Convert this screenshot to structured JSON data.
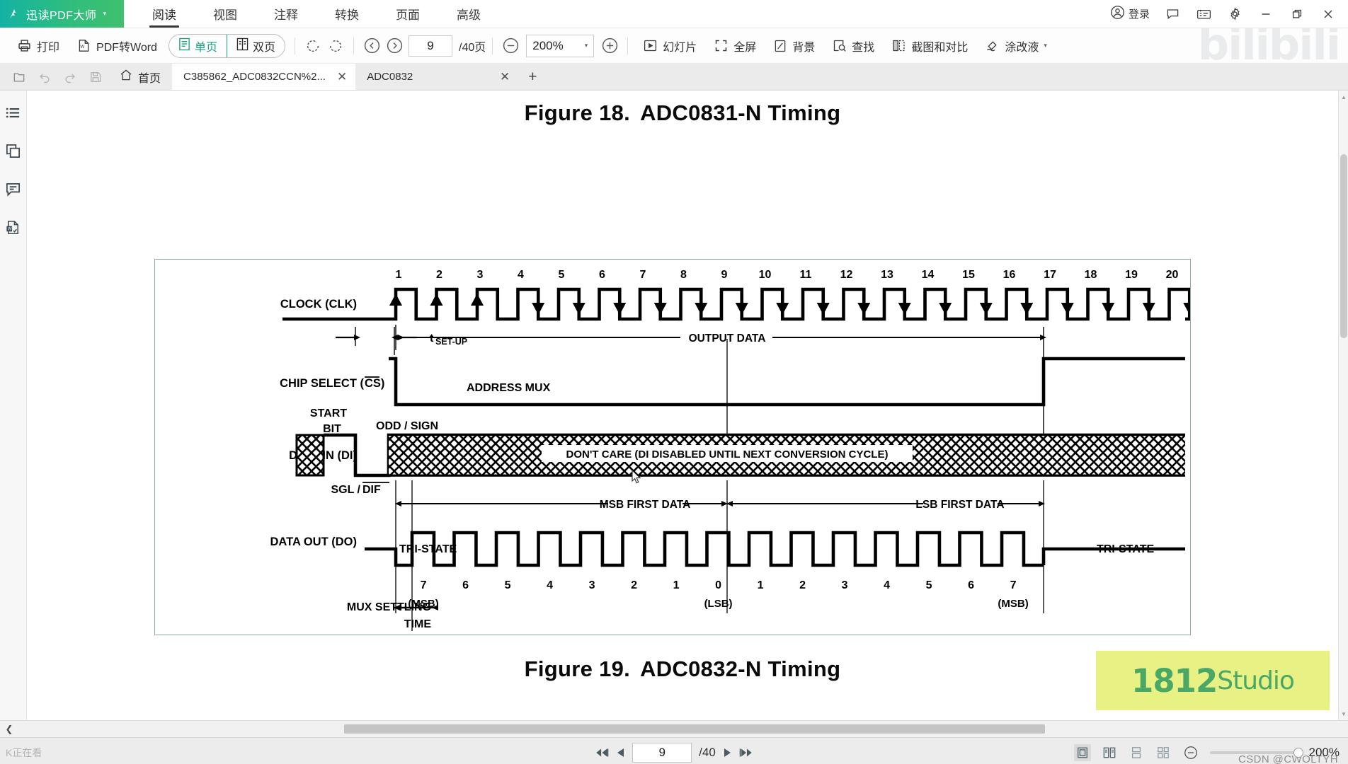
{
  "app": {
    "brand": "迅读PDF大师",
    "brand_caret": "▾",
    "accent": "#2fbd7e",
    "login_label": "登录",
    "watermark_bili": "bilibili",
    "watermark_studio_num": "1812",
    "watermark_studio_word": "Studio",
    "watermark_csdn": "CSDN @CWOLTYH"
  },
  "menu": {
    "tabs": [
      {
        "label": "阅读",
        "active": true
      },
      {
        "label": "视图",
        "active": false
      },
      {
        "label": "注释",
        "active": false
      },
      {
        "label": "转换",
        "active": false
      },
      {
        "label": "页面",
        "active": false
      },
      {
        "label": "高级",
        "active": false
      }
    ]
  },
  "window_controls": {
    "feedback": "comment-icon",
    "keyboard": "keyboard-icon",
    "settings": "gear-icon",
    "minimize": "—",
    "restore": "restore-icon",
    "close": "✕"
  },
  "toolbar": {
    "print": "打印",
    "pdf_to_word": "PDF转Word",
    "single_page": "单页",
    "double_page": "双页",
    "page_mode_selected": "单页",
    "rotate_cw": "rotate-cw-icon",
    "rotate_ccw": "rotate-ccw-icon",
    "prev_page": "prev-page-icon",
    "next_page": "next-page-icon",
    "page_number": "9",
    "page_total": "/40页",
    "zoom_out": "zoom-out-icon",
    "zoom_value": "200%",
    "zoom_caret": "▾",
    "zoom_in": "zoom-in-icon",
    "slideshow": "幻灯片",
    "fullscreen": "全屏",
    "background": "背景",
    "find": "查找",
    "screenshot_compare": "截图和对比",
    "whiteout": "涂改液",
    "whiteout_caret": "▾"
  },
  "tabstrip": {
    "open_icon": "open-file-icon",
    "undo_icon": "undo-icon",
    "redo_icon": "redo-icon",
    "save_icon": "save-icon",
    "home_label": "首页",
    "tabs": [
      {
        "label": "C385862_ADC0832CCN%2...",
        "active": true,
        "close": "✕"
      },
      {
        "label": "ADC0832",
        "active": false,
        "close": "✕"
      }
    ],
    "add_tab": "+"
  },
  "sidebar": {
    "items": [
      {
        "name": "outline",
        "icon": "list-icon"
      },
      {
        "name": "thumbnails",
        "icon": "pages-icon"
      },
      {
        "name": "comments",
        "icon": "comment-bubble-icon"
      },
      {
        "name": "convert-word",
        "icon": "word-doc-icon"
      }
    ]
  },
  "document": {
    "figure_18_title_prefix": "Figure 18.",
    "figure_18_title_main": "ADC0831-N Timing",
    "figure_19_title_prefix": "Figure 19.",
    "figure_19_title_main": "ADC0832-N Timing"
  },
  "chart_data": {
    "type": "timing-diagram",
    "title": "ADC0831-N Timing",
    "signals": [
      {
        "name": "CLOCK (CLK)",
        "label": "CLOCK (CLK)"
      },
      {
        "name": "CHIP SELECT",
        "label": "CHIP SELECT (CS)",
        "overline": "CS"
      },
      {
        "name": "DATA IN",
        "label": "DATA IN (DI)"
      },
      {
        "name": "DATA OUT",
        "label": "DATA OUT (DO)"
      }
    ],
    "clock_numbers": [
      "1",
      "2",
      "3",
      "4",
      "5",
      "6",
      "7",
      "8",
      "9",
      "10",
      "11",
      "12",
      "13",
      "14",
      "15",
      "16",
      "17",
      "18",
      "19",
      "20"
    ],
    "clock_edge_arrows": {
      "rising": [
        1,
        2,
        3
      ],
      "falling": [
        4,
        5,
        6,
        7,
        8,
        9,
        10,
        11,
        12,
        13,
        14,
        15,
        16,
        17,
        18,
        19,
        20
      ]
    },
    "annotations": [
      {
        "id": "t-setup",
        "text": "tSET-UP",
        "sub": "SET-UP"
      },
      {
        "id": "output-data",
        "text": "OUTPUT DATA"
      },
      {
        "id": "address-mux",
        "text": "ADDRESS MUX"
      },
      {
        "id": "start-bit",
        "text": "START\nBIT",
        "line1": "START",
        "line2": "BIT"
      },
      {
        "id": "odd-sign",
        "text": "ODD / SIGN"
      },
      {
        "id": "sgl-dif",
        "text": "SGL / DIF"
      },
      {
        "id": "dont-care",
        "text": "DON'T CARE (DI DISABLED UNTIL NEXT CONVERSION CYCLE)"
      },
      {
        "id": "msb-first",
        "text": "MSB FIRST DATA"
      },
      {
        "id": "lsb-first",
        "text": "LSB FIRST DATA"
      },
      {
        "id": "tri-state-left",
        "text": "TRI-STATE"
      },
      {
        "id": "tri-state-right",
        "text": "TRI-STATE"
      },
      {
        "id": "mux-settling",
        "line1": "MUX SETTLING",
        "line2": "TIME"
      }
    ],
    "data_out_bits": [
      {
        "n": "7",
        "tag": "(MSB)"
      },
      {
        "n": "6",
        "tag": ""
      },
      {
        "n": "5",
        "tag": ""
      },
      {
        "n": "4",
        "tag": ""
      },
      {
        "n": "3",
        "tag": ""
      },
      {
        "n": "2",
        "tag": ""
      },
      {
        "n": "1",
        "tag": ""
      },
      {
        "n": "0",
        "tag": "(LSB)"
      },
      {
        "n": "1",
        "tag": ""
      },
      {
        "n": "2",
        "tag": ""
      },
      {
        "n": "3",
        "tag": ""
      },
      {
        "n": "4",
        "tag": ""
      },
      {
        "n": "5",
        "tag": ""
      },
      {
        "n": "6",
        "tag": ""
      },
      {
        "n": "7",
        "tag": "(MSB)"
      }
    ]
  },
  "statusbar": {
    "left_text": "K正在看",
    "first_page": "first-page-icon",
    "prev_page": "prev-page-icon",
    "page_number": "9",
    "page_total": "/40",
    "next_page": "next-page-icon",
    "last_page": "last-page-icon",
    "view_single": "view-single-icon",
    "view_double": "view-double-icon",
    "view_scroll": "view-scroll-vertical-icon",
    "view_grid": "view-grid-icon",
    "zoom_minus": "−",
    "zoom_value": "200%"
  }
}
